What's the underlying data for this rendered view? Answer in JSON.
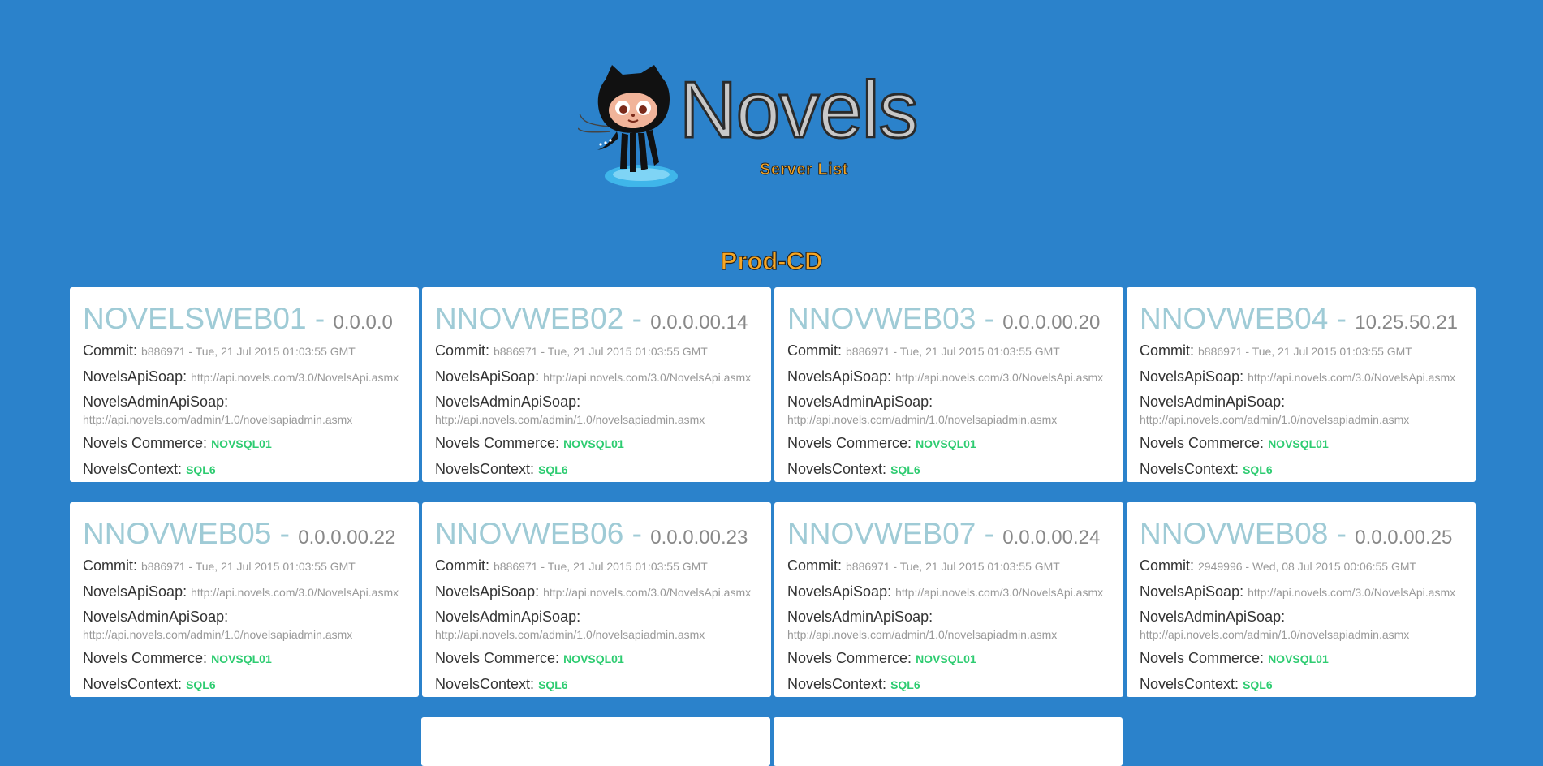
{
  "header": {
    "logo_title": "Novels",
    "logo_subtitle": "Server List"
  },
  "section": {
    "title": "Prod-CD"
  },
  "labels": {
    "commit": "Commit:",
    "api_soap": "NovelsApiSoap:",
    "admin_api_soap": "NovelsAdminApiSoap:",
    "commerce": "Novels Commerce:",
    "context": "NovelsContext:"
  },
  "servers": [
    {
      "host": "NOVELSWEB01",
      "version": "0.0.0.0",
      "commit": "b886971 - Tue, 21 Jul 2015 01:03:55 GMT",
      "api_soap": "http://api.novels.com/3.0/NovelsApi.asmx",
      "admin_api_soap": "http://api.novels.com/admin/1.0/novelsapiadmin.asmx",
      "commerce": "NOVSQL01",
      "context": "SQL6"
    },
    {
      "host": "NNOVWEB02",
      "version": "0.0.0.00.14",
      "commit": "b886971 - Tue, 21 Jul 2015 01:03:55 GMT",
      "api_soap": "http://api.novels.com/3.0/NovelsApi.asmx",
      "admin_api_soap": "http://api.novels.com/admin/1.0/novelsapiadmin.asmx",
      "commerce": "NOVSQL01",
      "context": "SQL6"
    },
    {
      "host": "NNOVWEB03",
      "version": "0.0.0.00.20",
      "commit": "b886971 - Tue, 21 Jul 2015 01:03:55 GMT",
      "api_soap": "http://api.novels.com/3.0/NovelsApi.asmx",
      "admin_api_soap": "http://api.novels.com/admin/1.0/novelsapiadmin.asmx",
      "commerce": "NOVSQL01",
      "context": "SQL6"
    },
    {
      "host": "NNOVWEB04",
      "version": "10.25.50.21",
      "commit": "b886971 - Tue, 21 Jul 2015 01:03:55 GMT",
      "api_soap": "http://api.novels.com/3.0/NovelsApi.asmx",
      "admin_api_soap": "http://api.novels.com/admin/1.0/novelsapiadmin.asmx",
      "commerce": "NOVSQL01",
      "context": "SQL6"
    },
    {
      "host": "NNOVWEB05",
      "version": "0.0.0.00.22",
      "commit": "b886971 - Tue, 21 Jul 2015 01:03:55 GMT",
      "api_soap": "http://api.novels.com/3.0/NovelsApi.asmx",
      "admin_api_soap": "http://api.novels.com/admin/1.0/novelsapiadmin.asmx",
      "commerce": "NOVSQL01",
      "context": "SQL6"
    },
    {
      "host": "NNOVWEB06",
      "version": "0.0.0.00.23",
      "commit": "b886971 - Tue, 21 Jul 2015 01:03:55 GMT",
      "api_soap": "http://api.novels.com/3.0/NovelsApi.asmx",
      "admin_api_soap": "http://api.novels.com/admin/1.0/novelsapiadmin.asmx",
      "commerce": "NOVSQL01",
      "context": "SQL6"
    },
    {
      "host": "NNOVWEB07",
      "version": "0.0.0.00.24",
      "commit": "b886971 - Tue, 21 Jul 2015 01:03:55 GMT",
      "api_soap": "http://api.novels.com/3.0/NovelsApi.asmx",
      "admin_api_soap": "http://api.novels.com/admin/1.0/novelsapiadmin.asmx",
      "commerce": "NOVSQL01",
      "context": "SQL6"
    },
    {
      "host": "NNOVWEB08",
      "version": "0.0.0.00.25",
      "commit": "2949996 - Wed, 08 Jul 2015 00:06:55 GMT",
      "api_soap": "http://api.novels.com/3.0/NovelsApi.asmx",
      "admin_api_soap": "http://api.novels.com/admin/1.0/novelsapiadmin.asmx",
      "commerce": "NOVSQL01",
      "context": "SQL6"
    }
  ]
}
